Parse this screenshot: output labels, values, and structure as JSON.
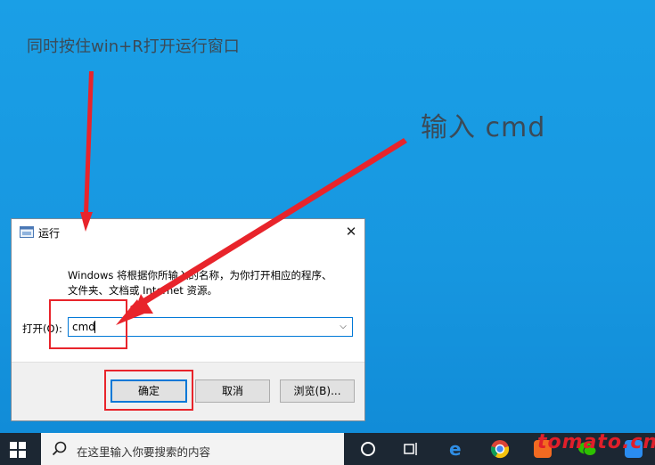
{
  "annotations": {
    "top_text": "同时按住win+R打开运行窗口",
    "right_text": "输入  cmd"
  },
  "dialog": {
    "title": "运行",
    "description_line1": "Windows 将根据你所输入的名称，为你打开相应的程序、",
    "description_line2": "文件夹、文档或 Internet 资源。",
    "open_label": "打开(O):",
    "input_value": "cmd",
    "ok_label": "确定",
    "cancel_label": "取消",
    "browse_label": "浏览(B)..."
  },
  "taskbar": {
    "search_placeholder": "在这里输入你要搜索的内容"
  },
  "watermark": "tomato.cn",
  "colors": {
    "desktop": "#1797e0",
    "highlight": "#e8242b",
    "accent": "#0078d7",
    "taskbar": "#1c2733"
  }
}
